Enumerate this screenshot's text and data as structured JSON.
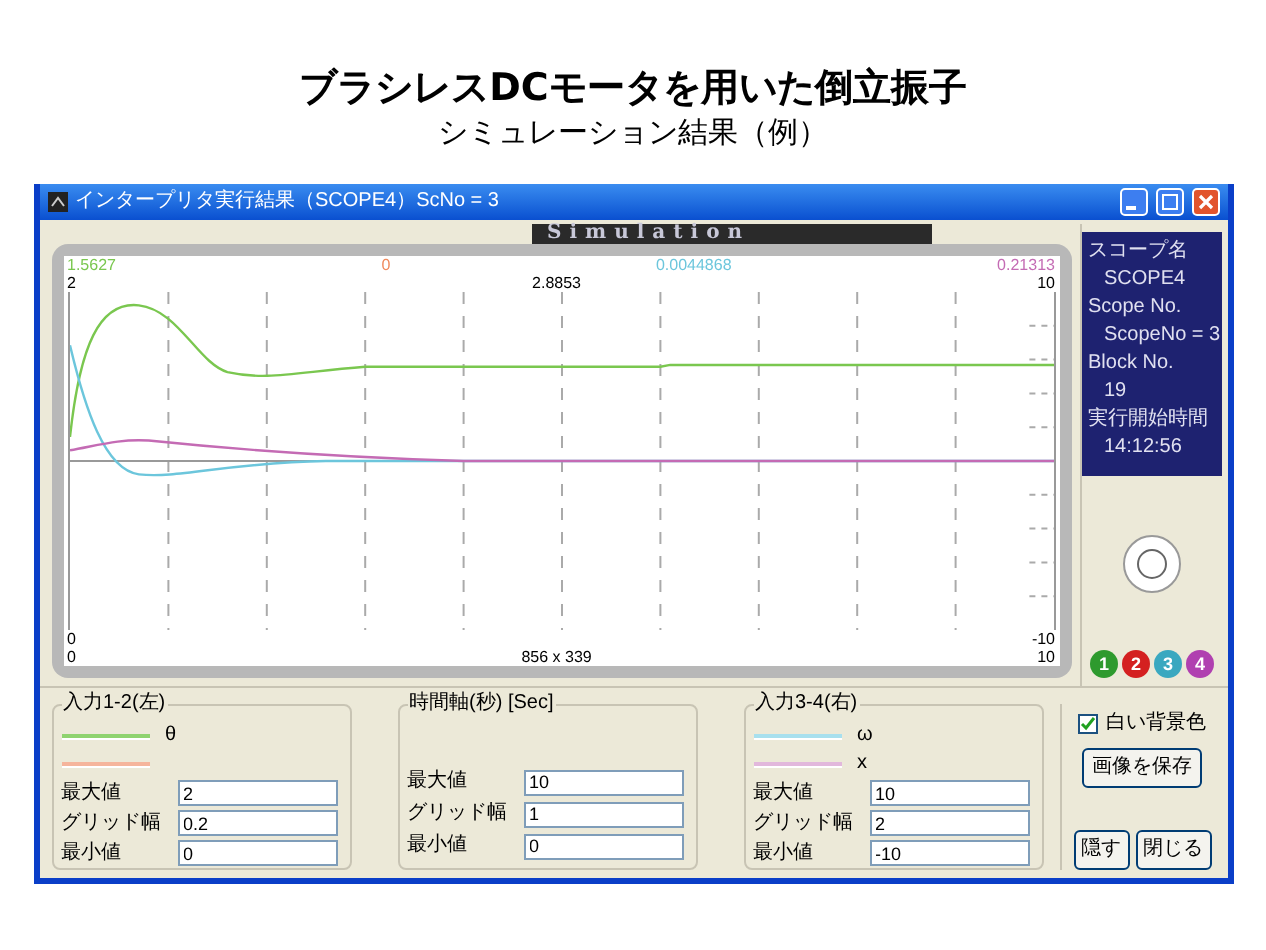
{
  "slide": {
    "title": "ブラシレスDCモータを用いた倒立振子",
    "subtitle": "シミュレーション結果（例）"
  },
  "window": {
    "title": "インタープリタ実行結果（SCOPE4）ScNo = 3",
    "banner": "Simulation"
  },
  "scope": {
    "top_values": [
      {
        "text": "1.5627",
        "color": "#7ac74f"
      },
      {
        "text": "0",
        "color": "#f08a5d"
      },
      {
        "text": "0.0044868",
        "color": "#6cc6dc"
      },
      {
        "text": "0.21313",
        "color": "#c46bb4"
      }
    ],
    "y_left_max": "2",
    "center_value": "2.8853",
    "y_right_max": "10",
    "y_left_min": "0",
    "y_right_min": "-10",
    "x_min": "0",
    "size": "856 x 339",
    "x_max": "10"
  },
  "info": [
    "スコープ名",
    "SCOPE4",
    "Scope No.",
    "ScopeNo = 3",
    "Block No.",
    "19",
    "実行開始時間",
    "14:12:56"
  ],
  "channels": [
    {
      "label": "1",
      "color": "#2e9a2e"
    },
    {
      "label": "2",
      "color": "#d42020"
    },
    {
      "label": "3",
      "color": "#3aa8c0"
    },
    {
      "label": "4",
      "color": "#b040b0"
    }
  ],
  "groups": [
    {
      "title": "入力1-2(左)",
      "legend": [
        {
          "color": "#8fd36f",
          "label": "θ"
        },
        {
          "color": "#f5b59c"
        }
      ],
      "fields": [
        {
          "label": "最大値",
          "value": "2"
        },
        {
          "label": "グリッド幅",
          "value": "0.2"
        },
        {
          "label": "最小値",
          "value": "0"
        }
      ]
    },
    {
      "title": "時間軸(秒) [Sec]",
      "fields": [
        {
          "label": "最大値",
          "value": "10"
        },
        {
          "label": "グリッド幅",
          "value": "1"
        },
        {
          "label": "最小値",
          "value": "0"
        }
      ]
    },
    {
      "title": "入力3-4(右)",
      "legend": [
        {
          "color": "#a8e0ee",
          "label": "ω"
        },
        {
          "color": "#e2b8dc",
          "label": "x"
        }
      ],
      "fields": [
        {
          "label": "最大値",
          "value": "10"
        },
        {
          "label": "グリッド幅",
          "value": "2"
        },
        {
          "label": "最小値",
          "value": "-10"
        }
      ]
    }
  ],
  "white_background": {
    "label": "白い背景色",
    "checked": true
  },
  "buttons": [
    "画像を保存",
    "隠す",
    "閉じる"
  ]
}
